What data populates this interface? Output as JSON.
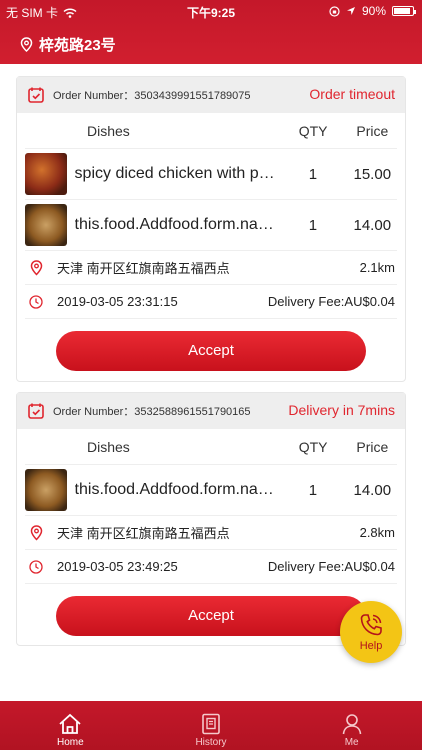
{
  "status_bar": {
    "carrier": "无 SIM 卡",
    "time": "下午9:25",
    "battery": "90%"
  },
  "header": {
    "location": "梓苑路23号"
  },
  "columns": {
    "dishes": "Dishes",
    "qty": "QTY",
    "price": "Price"
  },
  "orders": [
    {
      "number_label": "Order Number：3503439991551789075",
      "status": "Order timeout",
      "dishes": [
        {
          "name": "spicy diced chicken with peanuts",
          "qty": "1",
          "price": "15.00",
          "image": "spicy-chicken-photo"
        },
        {
          "name": "this.food.Addfood.form.name",
          "qty": "1",
          "price": "14.00",
          "image": "braised-tofu-photo"
        }
      ],
      "address": "天津 南开区红旗南路五福西点",
      "distance": "2.1km",
      "datetime": "2019-03-05 23:31:15",
      "delivery_fee": "Delivery Fee:AU$0.04",
      "accept_label": "Accept"
    },
    {
      "number_label": "Order Number：3532588961551790165",
      "status": "Delivery in 7mins",
      "dishes": [
        {
          "name": "this.food.Addfood.form.name",
          "qty": "1",
          "price": "14.00",
          "image": "braised-tofu-photo"
        }
      ],
      "address": "天津 南开区红旗南路五福西点",
      "distance": "2.8km",
      "datetime": "2019-03-05 23:49:25",
      "delivery_fee": "Delivery Fee:AU$0.04",
      "accept_label": "Accept"
    }
  ],
  "help": {
    "label": "Help"
  },
  "tabs": [
    {
      "label": "Home",
      "icon": "home-icon",
      "active": true
    },
    {
      "label": "History",
      "icon": "history-icon",
      "active": false
    },
    {
      "label": "Me",
      "icon": "user-icon",
      "active": false
    }
  ],
  "colors": {
    "brand": "#c4182a",
    "accent": "#e0262f",
    "help": "#f3c515"
  }
}
